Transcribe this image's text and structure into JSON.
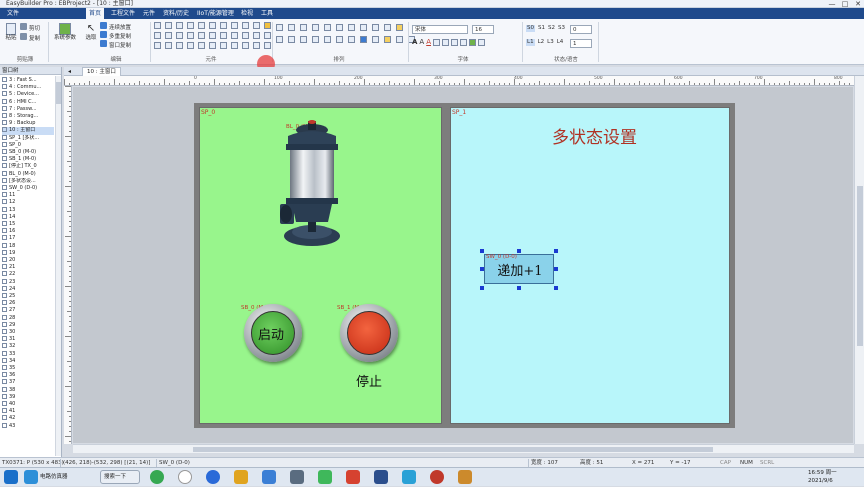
{
  "window": {
    "title": "EasyBuilder Pro : EBProject2 - [10 : 主窗口]",
    "controls": [
      "—",
      "□",
      "✕"
    ]
  },
  "menu": {
    "items": [
      "文件",
      "首页",
      "工程文件",
      "元件",
      "资料/历史",
      "IIoT/能源管理",
      "检视",
      "工具"
    ],
    "active_index": 1
  },
  "ribbon": {
    "groups": [
      {
        "label": "剪贴簿",
        "buttons": [
          "粘贴",
          "剪切",
          "复制"
        ]
      },
      {
        "label": "编辑",
        "buttons": [
          "系统参数",
          "选取",
          "连续放置",
          "多重复制",
          "窗口复制"
        ]
      },
      {
        "label": "元件",
        "buttons": []
      },
      {
        "label": "排列",
        "buttons": []
      },
      {
        "label": "字体",
        "buttons": []
      },
      {
        "label": "状态/语言",
        "buttons": []
      }
    ],
    "font_name": "宋体",
    "font_size": "16",
    "state_value": "0",
    "language_value": "1",
    "state_labels": [
      "S0",
      "S1",
      "S2",
      "S3"
    ],
    "layer_labels": [
      "L1",
      "L2",
      "L3",
      "L4"
    ]
  },
  "tree": {
    "header": "窗口树",
    "items": [
      "3 : Fast S...",
      "4 : Commu...",
      "5 : Device...",
      "6 : HMI C...",
      "7 : Passw...",
      "8 : Storag...",
      "9 : Backup",
      "10 : 主窗口",
      "SP_1 [多状...",
      "SP_0",
      "SB_0 (M-0)",
      "SB_1 (M-0)",
      "[停止] TX_0",
      "BL_0 (M-0)",
      "[多状态设...",
      "SW_0 (D-0)",
      "11",
      "12",
      "13",
      "14",
      "15",
      "16",
      "17",
      "18",
      "19",
      "20",
      "21",
      "22",
      "23",
      "24",
      "25",
      "26",
      "27",
      "28",
      "29",
      "30",
      "31",
      "32",
      "33",
      "34",
      "35",
      "36",
      "37",
      "38",
      "39",
      "40",
      "41",
      "42",
      "43"
    ],
    "selected_index": 7
  },
  "doc_tab": "10 : 主窗口",
  "ruler_numbers": [
    "0",
    "100",
    "200",
    "300",
    "400",
    "500",
    "600",
    "700",
    "800"
  ],
  "screen": {
    "sp0_label": "SP_0",
    "sp1_label": "SP_1",
    "bl0_label": "BL_0 (M-0)",
    "sb0_label": "SB_0 (M-0)",
    "sb1_label": "SB_1 (M-0)",
    "start_text": "启动",
    "stop_text": "停止",
    "title_text": "多状态设置",
    "sw0_label": "SW_0 (D-0)",
    "sw0_text": "递加+1"
  },
  "status": {
    "cursor": "TX0371: P (530 x 483)",
    "coords": "(426, 218)-(532, 298) [(21, 14)]",
    "selected": "SW_0 (D-0)",
    "width": "宽度 : 107",
    "height": "高度 : 51",
    "x": "X = 271",
    "y": "Y = -17",
    "cap": "CAP",
    "num": "NUM",
    "scrl": "SCRL"
  },
  "taskbar": {
    "items": [
      "电路仿真器",
      "搜索一下"
    ],
    "clock_time": "16:59 周一",
    "clock_date": "2021/9/6"
  },
  "colors": {
    "sp0_bg": "#98f58c",
    "sp1_bg": "#b8f6fa",
    "label_red": "#c0392b",
    "start_button": "#49b43c",
    "stop_button": "#e2412a",
    "menu_bar": "#1f4a8c"
  }
}
